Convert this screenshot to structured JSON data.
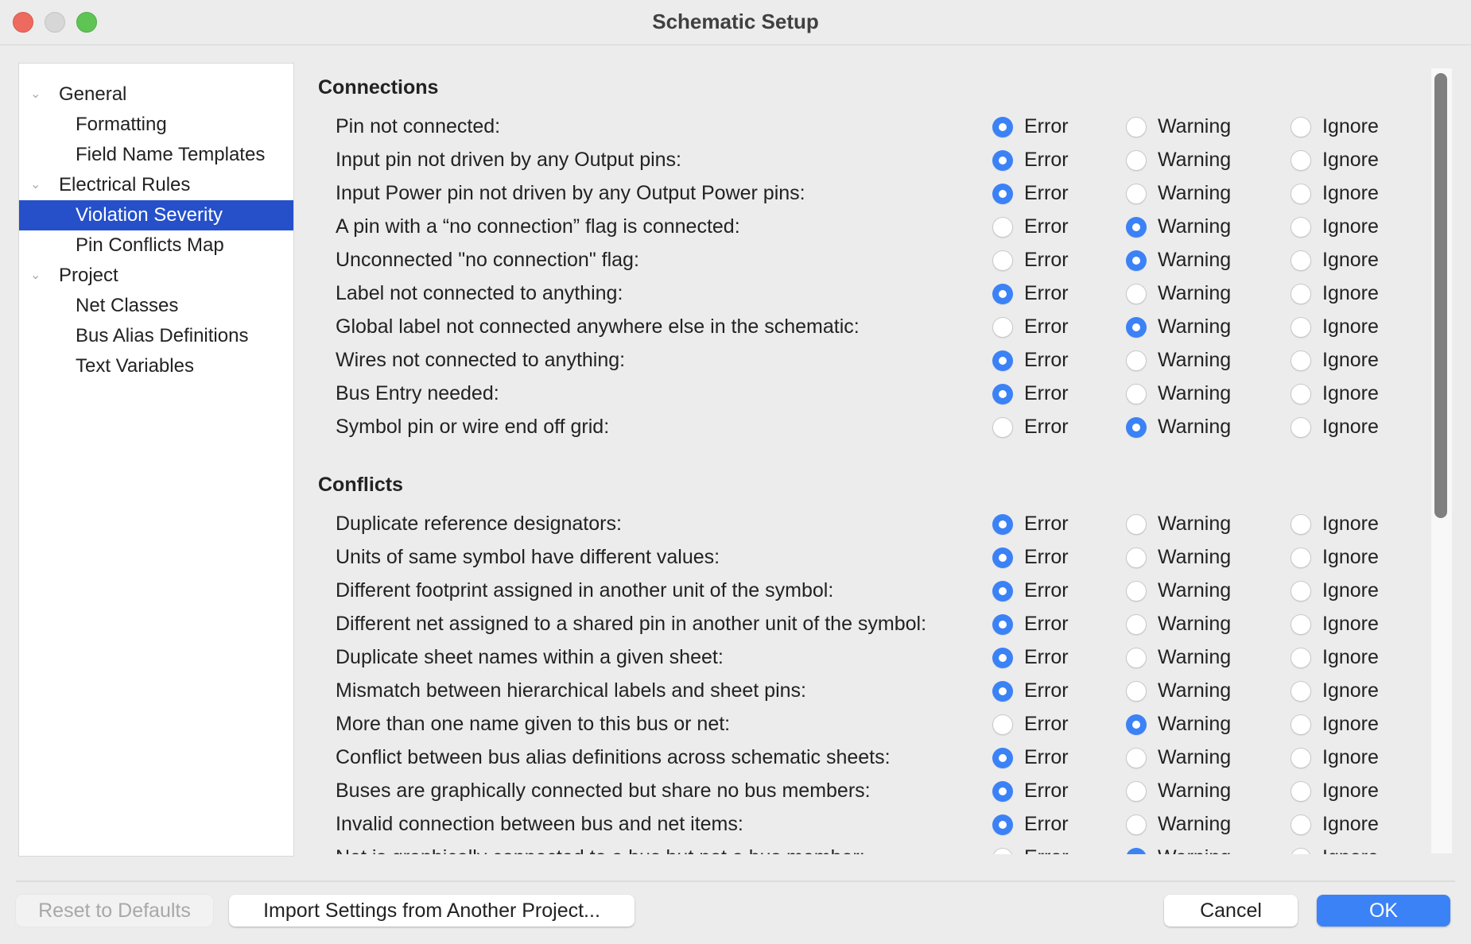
{
  "window": {
    "title": "Schematic Setup"
  },
  "tree": [
    {
      "label": "General",
      "level": 1,
      "expanded": true,
      "selected": false
    },
    {
      "label": "Formatting",
      "level": 2,
      "selected": false
    },
    {
      "label": "Field Name Templates",
      "level": 2,
      "selected": false
    },
    {
      "label": "Electrical Rules",
      "level": 1,
      "expanded": true,
      "selected": false
    },
    {
      "label": "Violation Severity",
      "level": 2,
      "selected": true
    },
    {
      "label": "Pin Conflicts Map",
      "level": 2,
      "selected": false
    },
    {
      "label": "Project",
      "level": 1,
      "expanded": true,
      "selected": false
    },
    {
      "label": "Net Classes",
      "level": 2,
      "selected": false
    },
    {
      "label": "Bus Alias Definitions",
      "level": 2,
      "selected": false
    },
    {
      "label": "Text Variables",
      "level": 2,
      "selected": false
    }
  ],
  "severity_options": {
    "error": "Error",
    "warning": "Warning",
    "ignore": "Ignore"
  },
  "sections": [
    {
      "title": "Connections",
      "rows": [
        {
          "label": "Pin not connected:",
          "severity": "error"
        },
        {
          "label": "Input pin not driven by any Output pins:",
          "severity": "error"
        },
        {
          "label": "Input Power pin not driven by any Output Power pins:",
          "severity": "error"
        },
        {
          "label": "A pin with a “no connection” flag is connected:",
          "severity": "warning"
        },
        {
          "label": "Unconnected \"no connection\" flag:",
          "severity": "warning"
        },
        {
          "label": "Label not connected to anything:",
          "severity": "error"
        },
        {
          "label": "Global label not connected anywhere else in the schematic:",
          "severity": "warning"
        },
        {
          "label": "Wires not connected to anything:",
          "severity": "error"
        },
        {
          "label": "Bus Entry needed:",
          "severity": "error"
        },
        {
          "label": "Symbol pin or wire end off grid:",
          "severity": "warning"
        }
      ]
    },
    {
      "title": "Conflicts",
      "rows": [
        {
          "label": "Duplicate reference designators:",
          "severity": "error"
        },
        {
          "label": "Units of same symbol have different values:",
          "severity": "error"
        },
        {
          "label": "Different footprint assigned in another unit of the symbol:",
          "severity": "error"
        },
        {
          "label": "Different net assigned to a shared pin in another unit of the symbol:",
          "severity": "error"
        },
        {
          "label": "Duplicate sheet names within a given sheet:",
          "severity": "error"
        },
        {
          "label": "Mismatch between hierarchical labels and sheet pins:",
          "severity": "error"
        },
        {
          "label": "More than one name given to this bus or net:",
          "severity": "warning"
        },
        {
          "label": "Conflict between bus alias definitions across schematic sheets:",
          "severity": "error"
        },
        {
          "label": "Buses are graphically connected but share no bus members:",
          "severity": "error"
        },
        {
          "label": "Invalid connection between bus and net items:",
          "severity": "error"
        },
        {
          "label": "Net is graphically connected to a bus but not a bus member:",
          "severity": "warning"
        }
      ]
    }
  ],
  "footer": {
    "reset_label": "Reset to Defaults",
    "import_label": "Import Settings from Another Project...",
    "cancel_label": "Cancel",
    "ok_label": "OK"
  },
  "colors": {
    "accent": "#3b82f6",
    "selection": "#2550c9"
  }
}
